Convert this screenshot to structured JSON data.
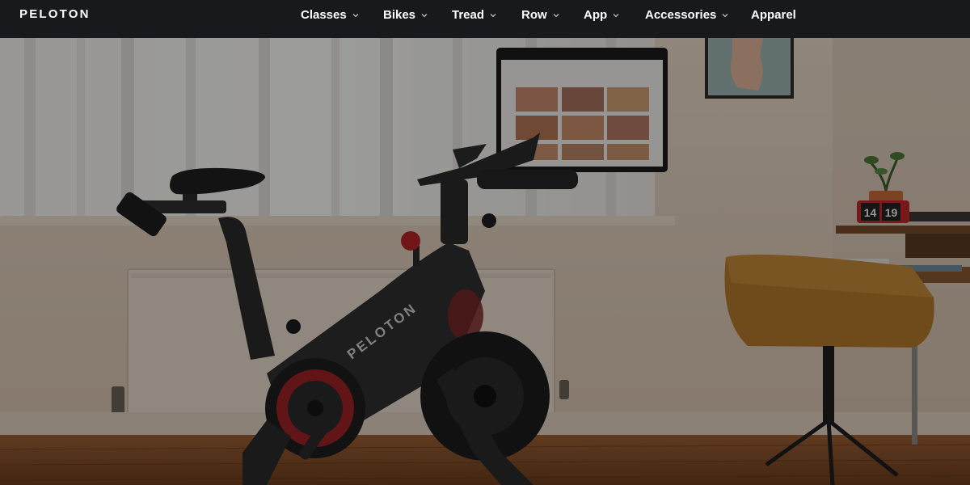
{
  "brand": {
    "name": "PELOTON"
  },
  "nav": {
    "items": [
      {
        "label": "Classes",
        "has_dropdown": true
      },
      {
        "label": "Bikes",
        "has_dropdown": true
      },
      {
        "label": "Tread",
        "has_dropdown": true
      },
      {
        "label": "Row",
        "has_dropdown": true
      },
      {
        "label": "App",
        "has_dropdown": true
      },
      {
        "label": "Accessories",
        "has_dropdown": true
      },
      {
        "label": "Apparel",
        "has_dropdown": false
      }
    ]
  },
  "hero": {
    "bike_brand": "PELOTON",
    "clock": {
      "hour": "14",
      "minute": "19"
    }
  },
  "colors": {
    "header_bg": "#18191c",
    "header_text": "#ffffff",
    "accent_red": "#c0282a"
  }
}
